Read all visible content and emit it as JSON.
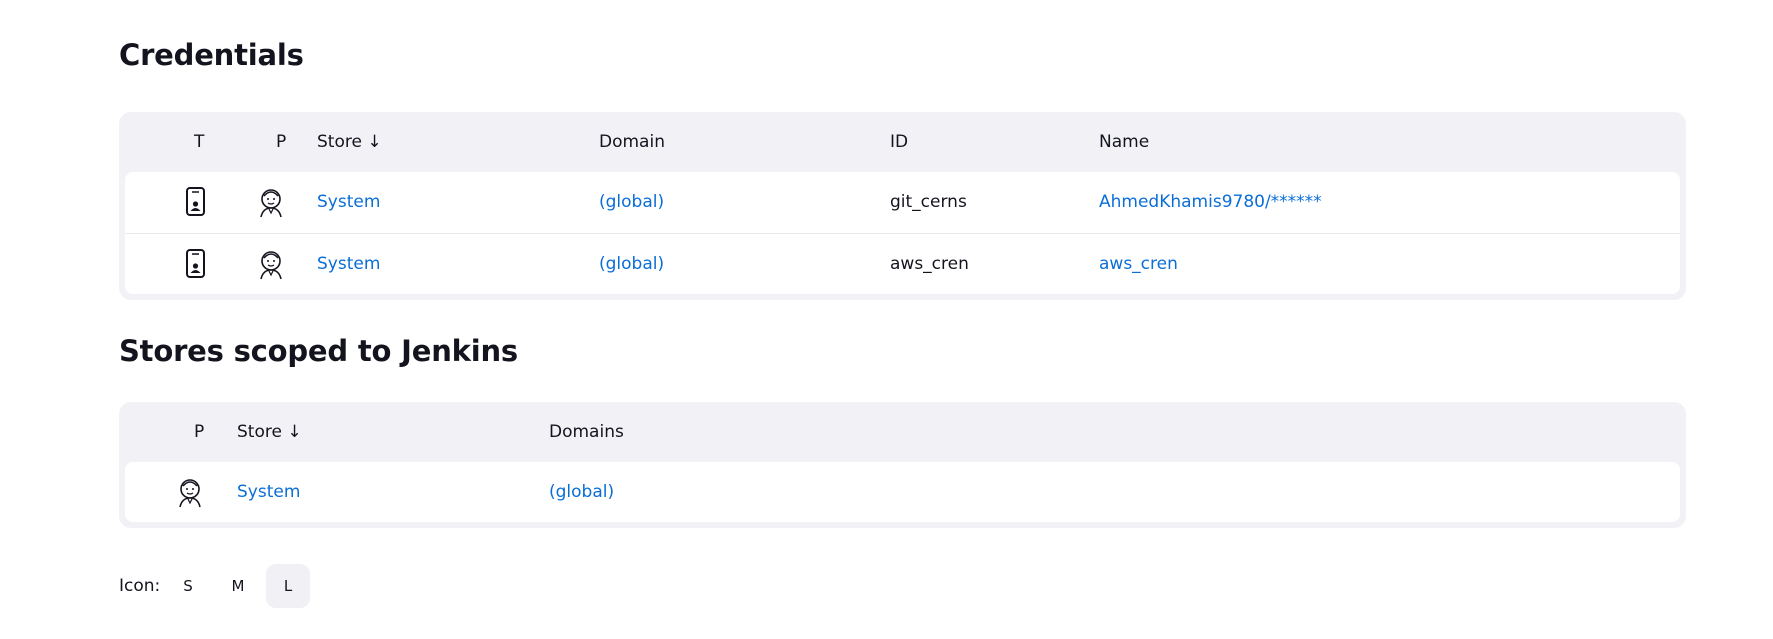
{
  "credentials": {
    "title": "Credentials",
    "columns": {
      "t": "T",
      "p": "P",
      "store": "Store ↓",
      "domain": "Domain",
      "id": "ID",
      "name": "Name"
    },
    "rows": [
      {
        "type_icon": "credential-card-icon",
        "provider_icon": "jenkins-icon",
        "store": "System",
        "domain": "(global)",
        "id": "git_cerns",
        "name": "AhmedKhamis9780/******"
      },
      {
        "type_icon": "credential-card-icon",
        "provider_icon": "jenkins-icon",
        "store": "System",
        "domain": "(global)",
        "id": "aws_cren",
        "name": "aws_cren"
      }
    ]
  },
  "stores": {
    "title": "Stores scoped to Jenkins",
    "columns": {
      "p": "P",
      "store": "Store ↓",
      "domains": "Domains"
    },
    "rows": [
      {
        "provider_icon": "jenkins-icon",
        "store": "System",
        "domains": "(global)"
      }
    ]
  },
  "icon_size": {
    "label": "Icon:",
    "options": [
      "S",
      "M",
      "L"
    ],
    "selected": "L"
  },
  "colors": {
    "link": "#0a6ed6",
    "panel": "#f2f2f6",
    "text": "#14141f"
  }
}
